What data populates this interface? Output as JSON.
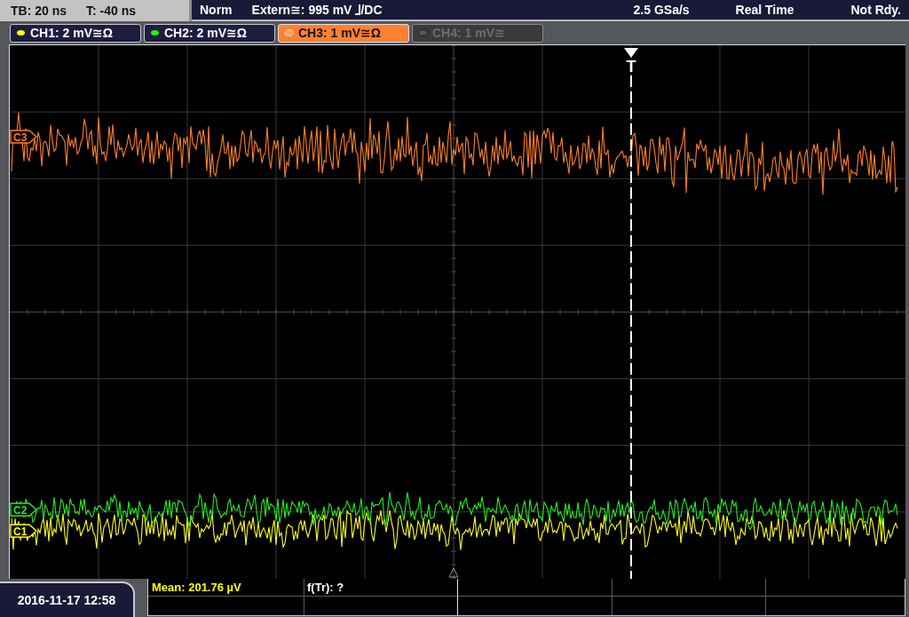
{
  "status_bar": {
    "timebase": "TB: 20 ns",
    "trigger_offset": "T: -40 ns",
    "trigger_mode": "Norm",
    "trigger_source": "Extern≅: 995 mV",
    "trigger_coupling": "/DC",
    "sample_rate": "2.5 GSa/s",
    "acquisition_mode": "Real Time",
    "state": "Not Rdy."
  },
  "channels": [
    {
      "label": "CH1: 2 mV≅Ω",
      "color": "#ffff1a",
      "selected": false,
      "enabled": true
    },
    {
      "label": "CH2: 2 mV≅Ω",
      "color": "#22ee22",
      "selected": false,
      "enabled": true
    },
    {
      "label": "CH3: 1 mV≅Ω",
      "color": "#ffa262",
      "selected": true,
      "enabled": true
    },
    {
      "label": "CH4: 1 mV≅",
      "color": "#555555",
      "selected": false,
      "enabled": false
    }
  ],
  "display": {
    "trigger_label": "T",
    "traces": [
      {
        "marker": "C3",
        "color": "#ff8022"
      },
      {
        "marker": "C2",
        "color": "#22ee22"
      },
      {
        "marker": "C1",
        "color": "#ffff1a"
      }
    ]
  },
  "footer": {
    "datetime": "2016-11-17 12:58",
    "measurements": [
      {
        "text": "Mean: 201.76 µV",
        "color": "#ffff00"
      },
      {
        "text": "f(Tr): ?",
        "color": "#ffffff"
      }
    ]
  }
}
